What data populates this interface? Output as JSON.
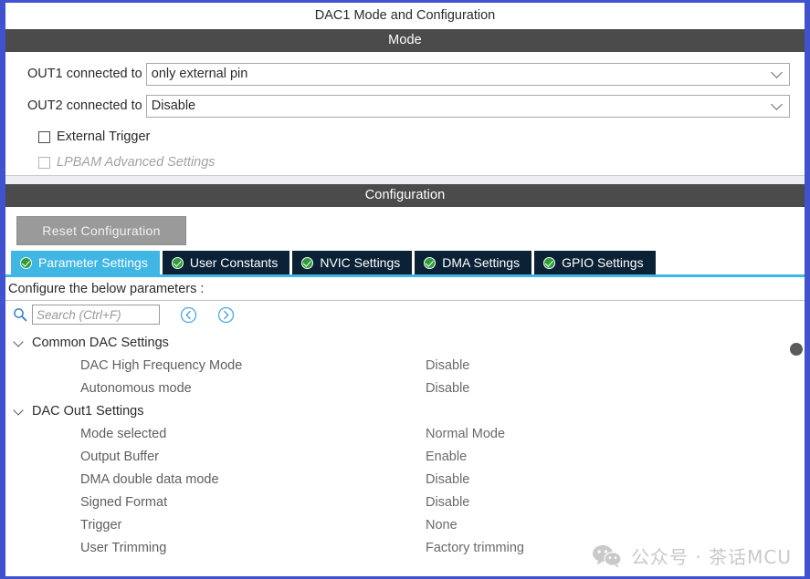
{
  "window": {
    "title": "DAC1 Mode and Configuration"
  },
  "mode_section": {
    "header": "Mode",
    "fields": [
      {
        "label": "OUT1 connected to",
        "value": "only external pin"
      },
      {
        "label": "OUT2 connected to",
        "value": "Disable"
      }
    ],
    "checkboxes": [
      {
        "label": "External Trigger",
        "checked": false,
        "enabled": true
      },
      {
        "label": "LPBAM Advanced Settings",
        "checked": false,
        "enabled": false
      }
    ]
  },
  "configuration_section": {
    "header": "Configuration",
    "reset_button": "Reset Configuration",
    "tabs": [
      {
        "label": "Parameter Settings",
        "active": true,
        "status_icon": "check-circle-icon"
      },
      {
        "label": "User Constants",
        "active": false,
        "status_icon": "check-circle-icon"
      },
      {
        "label": "NVIC Settings",
        "active": false,
        "status_icon": "check-circle-icon"
      },
      {
        "label": "DMA Settings",
        "active": false,
        "status_icon": "check-circle-icon"
      },
      {
        "label": "GPIO Settings",
        "active": false,
        "status_icon": "check-circle-icon"
      }
    ],
    "configure_hint": "Configure the below parameters :",
    "search": {
      "placeholder": "Search (Ctrl+F)",
      "value": "",
      "icon": "search-icon",
      "prev_icon": "chevron-left-circle-icon",
      "next_icon": "chevron-right-circle-icon"
    },
    "tree": [
      {
        "group": "Common DAC Settings",
        "expanded": true,
        "items": [
          {
            "name": "DAC High Frequency Mode",
            "value": "Disable"
          },
          {
            "name": "Autonomous mode",
            "value": "Disable"
          }
        ]
      },
      {
        "group": "DAC Out1 Settings",
        "expanded": true,
        "items": [
          {
            "name": "Mode selected",
            "value": "Normal Mode"
          },
          {
            "name": "Output Buffer",
            "value": "Enable"
          },
          {
            "name": "DMA double data mode",
            "value": "Disable"
          },
          {
            "name": "Signed Format",
            "value": "Disable"
          },
          {
            "name": "Trigger",
            "value": "None"
          },
          {
            "name": "User Trimming",
            "value": "Factory trimming"
          }
        ]
      }
    ]
  },
  "watermark": {
    "text": "公众号 · 茶话MCU",
    "icon": "wechat-icon"
  },
  "colors": {
    "window_border": "#4152cf",
    "section_header_bg": "#4b4b4b",
    "active_tab_bg": "#3fb6e4",
    "inactive_tab_bg": "#0b2135",
    "status_ok": "#2e9d3a",
    "reset_button_bg": "#9a9a9a"
  }
}
